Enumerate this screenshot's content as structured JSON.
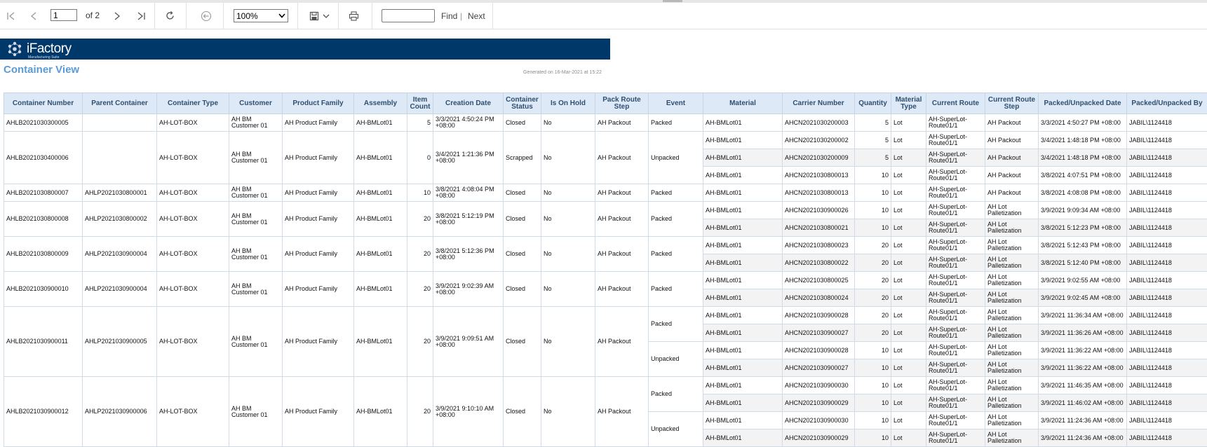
{
  "toolbar": {
    "page_value": "1",
    "of_label": "of 2",
    "zoom_value": "100%",
    "find_label": "Find",
    "separator": "|",
    "next_label": "Next"
  },
  "brand": {
    "name": "iFactory",
    "tagline": "Manufacturing Suite",
    "bar_color": "#00386a"
  },
  "report": {
    "title": "Container View",
    "generated": "Generated on 16-Mar-2021 at 15:22"
  },
  "columns": [
    "Container Number",
    "Parent Container",
    "Container Type",
    "Customer",
    "Product Family",
    "Assembly",
    "Item Count",
    "Creation Date",
    "Container Status",
    "Is On Hold",
    "Pack Route Step",
    "Event",
    "Material",
    "Carrier Number",
    "Quantity",
    "Material Type",
    "Current Route",
    "Current Route Step",
    "Packed/Unpacked Date",
    "Packed/Unpacked By"
  ],
  "containers": [
    {
      "number": "AHLB2021030300005",
      "parent": "",
      "type": "AH-LOT-BOX",
      "customer": "AH BM Customer 01",
      "family": "AH Product Family",
      "assembly": "AH-BMLot01",
      "count": "5",
      "created": "3/3/2021 4:50:24 PM +08:00",
      "status": "Closed",
      "hold": "No",
      "step": "AH Packout",
      "events": [
        {
          "event": "Packed",
          "items": [
            {
              "material": "AH-BMLot01",
              "carrier": "AHCN2021030200003",
              "qty": "5",
              "mtype": "Lot",
              "route": "AH-SuperLot-Route01/1",
              "rstep": "AH Packout",
              "date": "3/3/2021 4:50:27 PM +08:00",
              "by": "JABIL\\1124418"
            }
          ]
        }
      ]
    },
    {
      "number": "AHLB2021030400006",
      "parent": "",
      "type": "AH-LOT-BOX",
      "customer": "AH BM Customer 01",
      "family": "AH Product Family",
      "assembly": "AH-BMLot01",
      "count": "0",
      "created": "3/4/2021 1:21:36 PM +08:00",
      "status": "Scrapped",
      "hold": "No",
      "step": "AH Packout",
      "events": [
        {
          "event": "Unpacked",
          "items": [
            {
              "material": "AH-BMLot01",
              "carrier": "AHCN2021030200002",
              "qty": "5",
              "mtype": "Lot",
              "route": "AH-SuperLot-Route01/1",
              "rstep": "AH Packout",
              "date": "3/4/2021 1:48:18 PM +08:00",
              "by": "JABIL\\1124418"
            },
            {
              "material": "AH-BMLot01",
              "carrier": "AHCN2021030200009",
              "qty": "5",
              "mtype": "Lot",
              "route": "AH-SuperLot-Route01/1",
              "rstep": "AH Packout",
              "date": "3/4/2021 1:48:18 PM +08:00",
              "by": "JABIL\\1124418"
            },
            {
              "material": "AH-BMLot01",
              "carrier": "AHCN2021030800013",
              "qty": "10",
              "mtype": "Lot",
              "route": "AH-SuperLot-Route01/1",
              "rstep": "AH Packout",
              "date": "3/8/2021 4:07:51 PM +08:00",
              "by": "JABIL\\1124418"
            }
          ]
        }
      ]
    },
    {
      "number": "AHLB2021030800007",
      "parent": "AHLP2021030800001",
      "type": "AH-LOT-BOX",
      "customer": "AH BM Customer 01",
      "family": "AH Product Family",
      "assembly": "AH-BMLot01",
      "count": "10",
      "created": "3/8/2021 4:08:04 PM +08:00",
      "status": "Closed",
      "hold": "No",
      "step": "AH Packout",
      "events": [
        {
          "event": "Packed",
          "items": [
            {
              "material": "AH-BMLot01",
              "carrier": "AHCN2021030800013",
              "qty": "10",
              "mtype": "Lot",
              "route": "AH-SuperLot-Route01/1",
              "rstep": "AH Packout",
              "date": "3/8/2021 4:08:08 PM +08:00",
              "by": "JABIL\\1124418"
            }
          ]
        }
      ]
    },
    {
      "number": "AHLB2021030800008",
      "parent": "AHLP2021030800002",
      "type": "AH-LOT-BOX",
      "customer": "AH BM Customer 01",
      "family": "AH Product Family",
      "assembly": "AH-BMLot01",
      "count": "20",
      "created": "3/8/2021 5:12:19 PM +08:00",
      "status": "Closed",
      "hold": "No",
      "step": "AH Packout",
      "events": [
        {
          "event": "Packed",
          "items": [
            {
              "material": "AH-BMLot01",
              "carrier": "AHCN2021030900026",
              "qty": "10",
              "mtype": "Lot",
              "route": "AH-SuperLot-Route01/1",
              "rstep": "AH Lot Palletization",
              "date": "3/9/2021 9:09:34 AM +08:00",
              "by": "JABIL\\1124418"
            },
            {
              "material": "AH-BMLot01",
              "carrier": "AHCN2021030800021",
              "qty": "10",
              "mtype": "Lot",
              "route": "AH-SuperLot-Route01/1",
              "rstep": "AH Lot Palletization",
              "date": "3/8/2021 5:12:23 PM +08:00",
              "by": "JABIL\\1124418"
            }
          ]
        }
      ]
    },
    {
      "number": "AHLB2021030800009",
      "parent": "AHLP2021030900004",
      "type": "AH-LOT-BOX",
      "customer": "AH BM Customer 01",
      "family": "AH Product Family",
      "assembly": "AH-BMLot01",
      "count": "20",
      "created": "3/8/2021 5:12:36 PM +08:00",
      "status": "Closed",
      "hold": "No",
      "step": "AH Packout",
      "events": [
        {
          "event": "Packed",
          "items": [
            {
              "material": "AH-BMLot01",
              "carrier": "AHCN2021030800023",
              "qty": "20",
              "mtype": "Lot",
              "route": "AH-SuperLot-Route01/1",
              "rstep": "AH Lot Palletization",
              "date": "3/8/2021 5:12:43 PM +08:00",
              "by": "JABIL\\1124418"
            },
            {
              "material": "AH-BMLot01",
              "carrier": "AHCN2021030800022",
              "qty": "20",
              "mtype": "Lot",
              "route": "AH-SuperLot-Route01/1",
              "rstep": "AH Lot Palletization",
              "date": "3/8/2021 5:12:40 PM +08:00",
              "by": "JABIL\\1124418"
            }
          ]
        }
      ]
    },
    {
      "number": "AHLB2021030900010",
      "parent": "AHLP2021030900004",
      "type": "AH-LOT-BOX",
      "customer": "AH BM Customer 01",
      "family": "AH Product Family",
      "assembly": "AH-BMLot01",
      "count": "20",
      "created": "3/9/2021 9:02:39 AM +08:00",
      "status": "Closed",
      "hold": "No",
      "step": "AH Packout",
      "events": [
        {
          "event": "Packed",
          "items": [
            {
              "material": "AH-BMLot01",
              "carrier": "AHCN2021030800025",
              "qty": "20",
              "mtype": "Lot",
              "route": "AH-SuperLot-Route01/1",
              "rstep": "AH Lot Palletization",
              "date": "3/9/2021 9:02:55 AM +08:00",
              "by": "JABIL\\1124418"
            },
            {
              "material": "AH-BMLot01",
              "carrier": "AHCN2021030800024",
              "qty": "20",
              "mtype": "Lot",
              "route": "AH-SuperLot-Route01/1",
              "rstep": "AH Lot Palletization",
              "date": "3/9/2021 9:02:45 AM +08:00",
              "by": "JABIL\\1124418"
            }
          ]
        }
      ]
    },
    {
      "number": "AHLB2021030900011",
      "parent": "AHLP2021030900005",
      "type": "AH-LOT-BOX",
      "customer": "AH BM Customer 01",
      "family": "AH Product Family",
      "assembly": "AH-BMLot01",
      "count": "20",
      "created": "3/9/2021 9:09:51 AM +08:00",
      "status": "Closed",
      "hold": "No",
      "step": "AH Packout",
      "events": [
        {
          "event": "Packed",
          "items": [
            {
              "material": "AH-BMLot01",
              "carrier": "AHCN2021030900028",
              "qty": "20",
              "mtype": "Lot",
              "route": "AH-SuperLot-Route01/1",
              "rstep": "AH Lot Palletization",
              "date": "3/9/2021 11:36:34 AM +08:00",
              "by": "JABIL\\1124418"
            },
            {
              "material": "AH-BMLot01",
              "carrier": "AHCN2021030900027",
              "qty": "20",
              "mtype": "Lot",
              "route": "AH-SuperLot-Route01/1",
              "rstep": "AH Lot Palletization",
              "date": "3/9/2021 11:36:26 AM +08:00",
              "by": "JABIL\\1124418"
            }
          ]
        },
        {
          "event": "Unpacked",
          "items": [
            {
              "material": "AH-BMLot01",
              "carrier": "AHCN2021030900028",
              "qty": "10",
              "mtype": "Lot",
              "route": "AH-SuperLot-Route01/1",
              "rstep": "AH Lot Palletization",
              "date": "3/9/2021 11:36:22 AM +08:00",
              "by": "JABIL\\1124418"
            },
            {
              "material": "AH-BMLot01",
              "carrier": "AHCN2021030900027",
              "qty": "10",
              "mtype": "Lot",
              "route": "AH-SuperLot-Route01/1",
              "rstep": "AH Lot Palletization",
              "date": "3/9/2021 11:36:22 AM +08:00",
              "by": "JABIL\\1124418"
            }
          ]
        }
      ]
    },
    {
      "number": "AHLB2021030900012",
      "parent": "AHLP2021030900006",
      "type": "AH-LOT-BOX",
      "customer": "AH BM Customer 01",
      "family": "AH Product Family",
      "assembly": "AH-BMLot01",
      "count": "20",
      "created": "3/9/2021 9:10:10 AM +08:00",
      "status": "Closed",
      "hold": "No",
      "step": "AH Packout",
      "events": [
        {
          "event": "Packed",
          "items": [
            {
              "material": "AH-BMLot01",
              "carrier": "AHCN2021030900030",
              "qty": "10",
              "mtype": "Lot",
              "route": "AH-SuperLot-Route01/1",
              "rstep": "AH Lot Palletization",
              "date": "3/9/2021 11:46:35 AM +08:00",
              "by": "JABIL\\1124418"
            },
            {
              "material": "AH-BMLot01",
              "carrier": "AHCN2021030900029",
              "qty": "10",
              "mtype": "Lot",
              "route": "AH-SuperLot-Route01/1",
              "rstep": "AH Lot Palletization",
              "date": "3/9/2021 11:46:02 AM +08:00",
              "by": "JABIL\\1124418"
            }
          ]
        },
        {
          "event": "Unpacked",
          "items": [
            {
              "material": "AH-BMLot01",
              "carrier": "AHCN2021030900030",
              "qty": "10",
              "mtype": "Lot",
              "route": "AH-SuperLot-Route01/1",
              "rstep": "AH Lot Palletization",
              "date": "3/9/2021 11:24:36 AM +08:00",
              "by": "JABIL\\1124418"
            },
            {
              "material": "AH-BMLot01",
              "carrier": "AHCN2021030900029",
              "qty": "10",
              "mtype": "Lot",
              "route": "AH-SuperLot-Route01/1",
              "rstep": "AH Lot Palletization",
              "date": "3/9/2021 11:24:36 AM +08:00",
              "by": "JABIL\\1124418"
            }
          ]
        }
      ]
    }
  ]
}
